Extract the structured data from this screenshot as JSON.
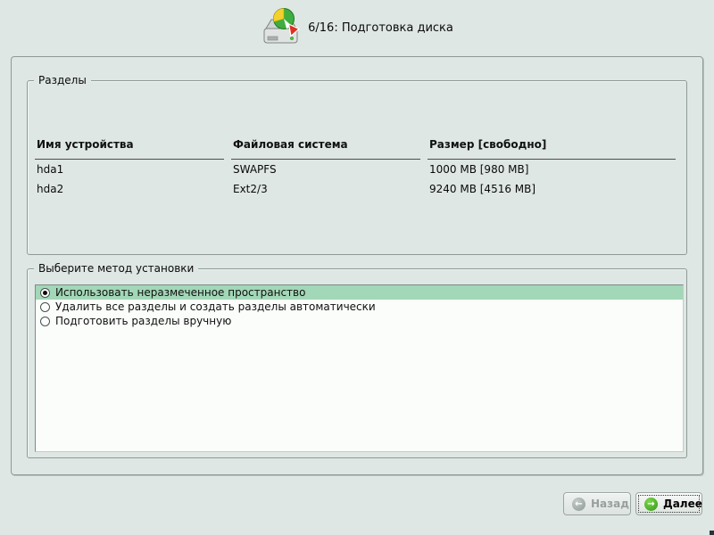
{
  "header": {
    "step_title": "6/16: Подготовка диска",
    "icon": "disk-pie-chart-icon"
  },
  "partitions_group": {
    "title": "Разделы",
    "table": {
      "columns": [
        "Имя устройства",
        "Файловая система",
        "Размер [свободно]"
      ],
      "rows": [
        [
          "hda1",
          "SWAPFS",
          "1000 MB [980 MB]"
        ],
        [
          "hda2",
          "Ext2/3",
          "9240 MB [4516 MB]"
        ]
      ]
    }
  },
  "method_group": {
    "title": "Выберите метод установки",
    "options": [
      {
        "label": "Использовать неразмеченное пространство",
        "selected": true
      },
      {
        "label": "Удалить все разделы и создать разделы автоматически",
        "selected": false
      },
      {
        "label": "Подготовить разделы вручную",
        "selected": false
      }
    ]
  },
  "footer": {
    "back_label": "Назад",
    "back_enabled": false,
    "next_label": "Далее",
    "back_icon": "back-arrow-icon",
    "next_icon": "next-arrow-icon"
  },
  "colors": {
    "window_background": "#dee7e4",
    "selection_highlight": "#a2d7b7",
    "list_background": "#fafdfa",
    "groupbox_border": "#8e9996",
    "next_icon_green": "#2f9a10",
    "disabled_text": "#97a09d"
  }
}
